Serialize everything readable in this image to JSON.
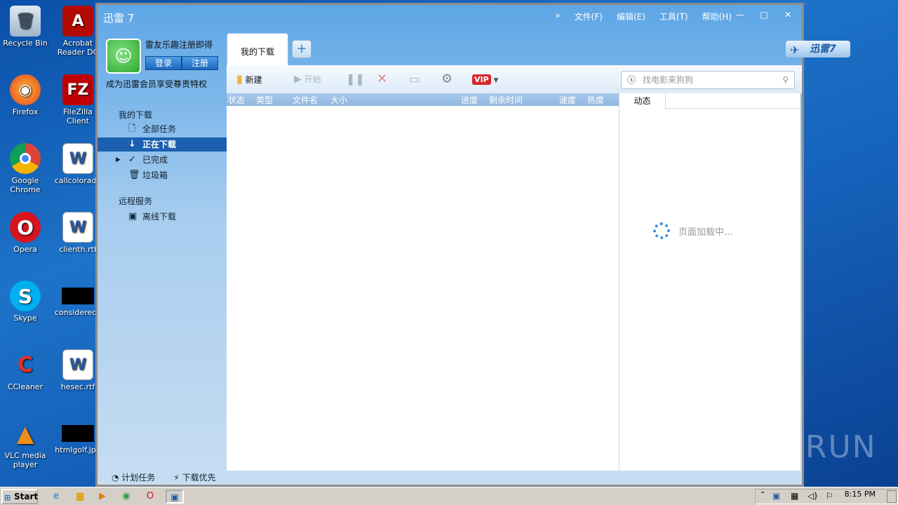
{
  "desktop": {
    "icons_left": [
      {
        "label": "Recycle Bin",
        "icon": "recycle-bin-icon"
      },
      {
        "label": "Firefox",
        "icon": "firefox-icon"
      },
      {
        "label": "Google Chrome",
        "icon": "chrome-icon"
      },
      {
        "label": "Opera",
        "icon": "opera-icon"
      },
      {
        "label": "Skype",
        "icon": "skype-icon"
      },
      {
        "label": "CCleaner",
        "icon": "ccleaner-icon"
      },
      {
        "label": "VLC media player",
        "icon": "vlc-icon"
      }
    ],
    "icons_right": [
      {
        "label": "Acrobat Reader DC",
        "icon": "acrobat-icon"
      },
      {
        "label": "FileZilla Client",
        "icon": "filezilla-icon"
      },
      {
        "label": "callcolorado",
        "icon": "word-doc-icon"
      },
      {
        "label": "clienth.rtf",
        "icon": "word-doc-icon"
      },
      {
        "label": "consideredc",
        "icon": "black-image-icon"
      },
      {
        "label": "hesec.rtf",
        "icon": "word-doc-icon"
      },
      {
        "label": "htmlgolf.jpg",
        "icon": "black-image-icon"
      }
    ]
  },
  "app": {
    "title": "迅雷 7",
    "menu": {
      "file": "文件(F)",
      "edit": "编辑(E)",
      "tools": "工具(T)",
      "help": "帮助(H)"
    },
    "promo_top": "雷友乐趣注册即得",
    "login_label": "登录",
    "register_label": "注册",
    "promo_vip": "成为迅雷会员享受尊贵特权",
    "sidebar": {
      "section_downloads": "我的下载",
      "items": [
        {
          "label": "全部任务"
        },
        {
          "label": "正在下载"
        },
        {
          "label": "已完成"
        },
        {
          "label": "垃圾箱"
        }
      ],
      "section_remote": "远程服务",
      "offline": "离线下载"
    },
    "bottom": {
      "schedule": "计划任务",
      "priority": "下载优先"
    },
    "tab_label": "我的下载",
    "toolbar": {
      "new": "新建",
      "start": "开始",
      "vip": "VIP"
    },
    "search_placeholder": "找电影来狗狗",
    "columns": [
      "状态",
      "类型",
      "文件名",
      "大小",
      "进度",
      "剩余时间",
      "速度",
      "热度"
    ],
    "feed_tab": "动态",
    "loading_text": "页面加载中...",
    "badge": "迅雷7"
  },
  "taskbar": {
    "start_label": "Start",
    "clock": "8:15 PM"
  },
  "watermark": "ANY RUN"
}
